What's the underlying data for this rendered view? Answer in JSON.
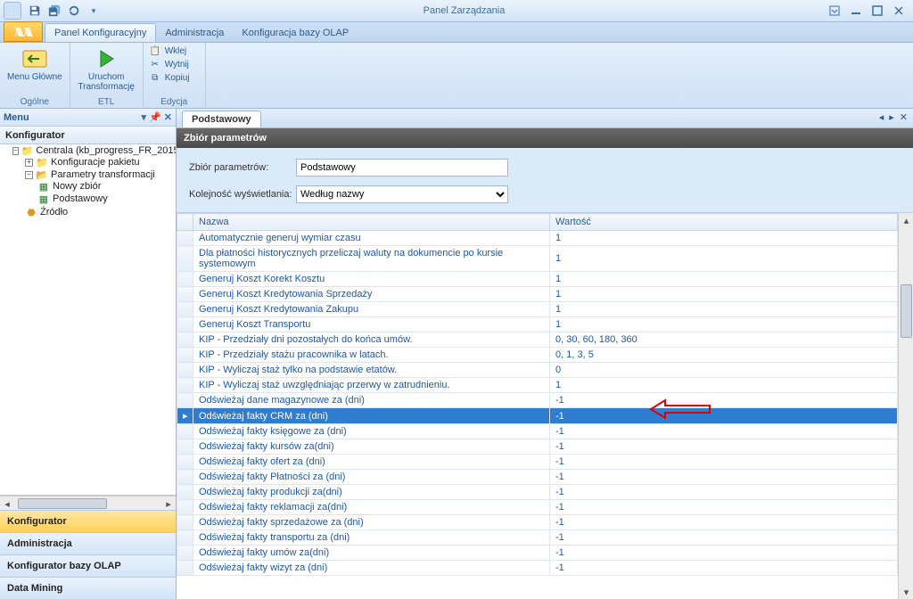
{
  "title": "Panel Zarządzania",
  "ribbon": {
    "tabs": [
      "Panel Konfiguracyjny",
      "Administracja",
      "Konfiguracja bazy OLAP"
    ],
    "group_ogolne": {
      "label": "Ogólne",
      "menu_glowne": "Menu Główne"
    },
    "group_etl": {
      "label": "ETL",
      "uruchom": "Uruchom\nTransformację"
    },
    "group_edycja": {
      "label": "Edycja",
      "wklej": "Wklej",
      "wytnij": "Wytnij",
      "kopiuj": "Kopiuj"
    }
  },
  "menuHeader": "Menu",
  "navGroups": [
    "Konfigurator",
    "Administracja",
    "Konfigurator bazy OLAP",
    "Data Mining"
  ],
  "tree": {
    "root": "Centrala (kb_progress_FR_2015",
    "konfiguracje": "Konfiguracje pakietu",
    "parametry": "Parametry transformacji",
    "nowy": "Nowy zbiór",
    "podstawowy": "Podstawowy",
    "zrodlo": "Źródło"
  },
  "docTab": "Podstawowy",
  "cardTitle": "Zbiór parametrów",
  "form": {
    "zbiorLabel": "Zbiór parametrów:",
    "zbiorValue": "Podstawowy",
    "kolejLabel": "Kolejność wyświetlania:",
    "kolejValue": "Według nazwy"
  },
  "columns": {
    "nazwa": "Nazwa",
    "wartosc": "Wartość"
  },
  "rows": [
    {
      "n": "Automatycznie generuj wymiar czasu",
      "v": "1"
    },
    {
      "n": "Dla płatności historycznych przeliczaj waluty na dokumencie po kursie systemowym",
      "v": "1"
    },
    {
      "n": "Generuj Koszt Korekt Kosztu",
      "v": "1"
    },
    {
      "n": "Generuj Koszt Kredytowania Sprzedaży",
      "v": "1"
    },
    {
      "n": "Generuj Koszt Kredytowania Zakupu",
      "v": "1"
    },
    {
      "n": "Generuj Koszt Transportu",
      "v": "1"
    },
    {
      "n": "KIP - Przedziały dni pozostałych do końca umów.",
      "v": "0, 30, 60, 180, 360"
    },
    {
      "n": "KIP - Przedziały stażu pracownika w latach.",
      "v": "0, 1, 3, 5"
    },
    {
      "n": "KIP - Wyliczaj staż tylko na podstawie etatów.",
      "v": "0"
    },
    {
      "n": "KIP - Wyliczaj staż uwzględniając przerwy w zatrudnieniu.",
      "v": "1"
    },
    {
      "n": "Odświeżaj dane magazynowe za (dni)",
      "v": "-1"
    },
    {
      "n": "Odświeżaj fakty CRM za (dni)",
      "v": "-1",
      "selected": true
    },
    {
      "n": "Odświeżaj fakty księgowe za (dni)",
      "v": "-1"
    },
    {
      "n": "Odświeżaj fakty kursów za(dni)",
      "v": "-1"
    },
    {
      "n": "Odświeżaj fakty ofert za (dni)",
      "v": "-1"
    },
    {
      "n": "Odświeżaj fakty Płatności za (dni)",
      "v": "-1"
    },
    {
      "n": "Odświeżaj fakty produkcji za(dni)",
      "v": "-1"
    },
    {
      "n": "Odświeżaj fakty reklamacji za(dni)",
      "v": "-1"
    },
    {
      "n": "Odświeżaj fakty sprzedażowe za (dni)",
      "v": "-1"
    },
    {
      "n": "Odświeżaj fakty transportu za (dni)",
      "v": "-1"
    },
    {
      "n": "Odświeżaj fakty umów za(dni)",
      "v": "-1"
    },
    {
      "n": "Odświeżaj fakty wizyt za (dni)",
      "v": "-1"
    }
  ]
}
